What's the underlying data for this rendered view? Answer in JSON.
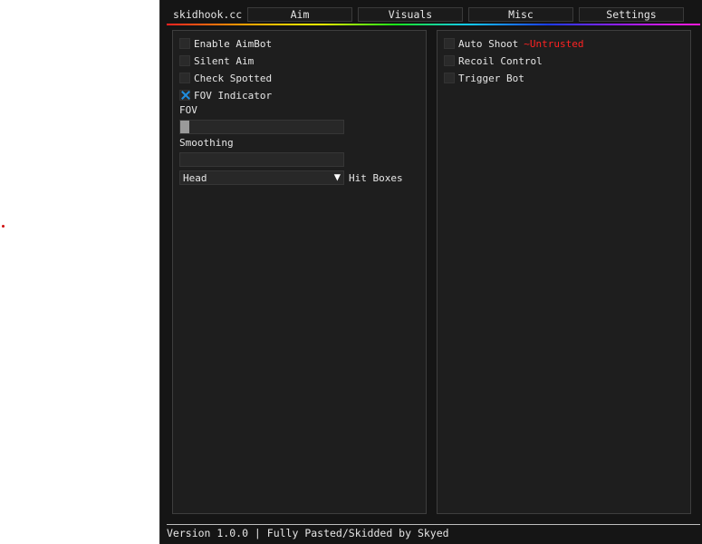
{
  "app": {
    "title": "skidhook.cc"
  },
  "tabs": [
    {
      "label": "Aim"
    },
    {
      "label": "Visuals"
    },
    {
      "label": "Misc"
    },
    {
      "label": "Settings"
    }
  ],
  "aim": {
    "left": {
      "checkboxes": [
        {
          "label": "Enable AimBot",
          "checked": false
        },
        {
          "label": "Silent Aim",
          "checked": false
        },
        {
          "label": "Check Spotted",
          "checked": false
        },
        {
          "label": "FOV Indicator",
          "checked": true
        }
      ],
      "fov": {
        "label": "FOV",
        "value_fraction": 0
      },
      "smoothing": {
        "label": "Smoothing",
        "value_fraction": null
      },
      "hitbox": {
        "selected": "Head",
        "label": "Hit Boxes"
      }
    },
    "right": {
      "checkboxes": [
        {
          "label": "Auto Shoot",
          "checked": false,
          "note": "~Untrusted"
        },
        {
          "label": "Recoil Control",
          "checked": false
        },
        {
          "label": "Trigger Bot",
          "checked": false
        }
      ]
    }
  },
  "footer": {
    "text": "Version 1.0.0 | Fully Pasted/Skidded by Skyed"
  },
  "colors": {
    "accent_check": "#1f8ee0",
    "warning": "#ff2222",
    "background": "#151515",
    "panel": "#1e1e1e"
  }
}
